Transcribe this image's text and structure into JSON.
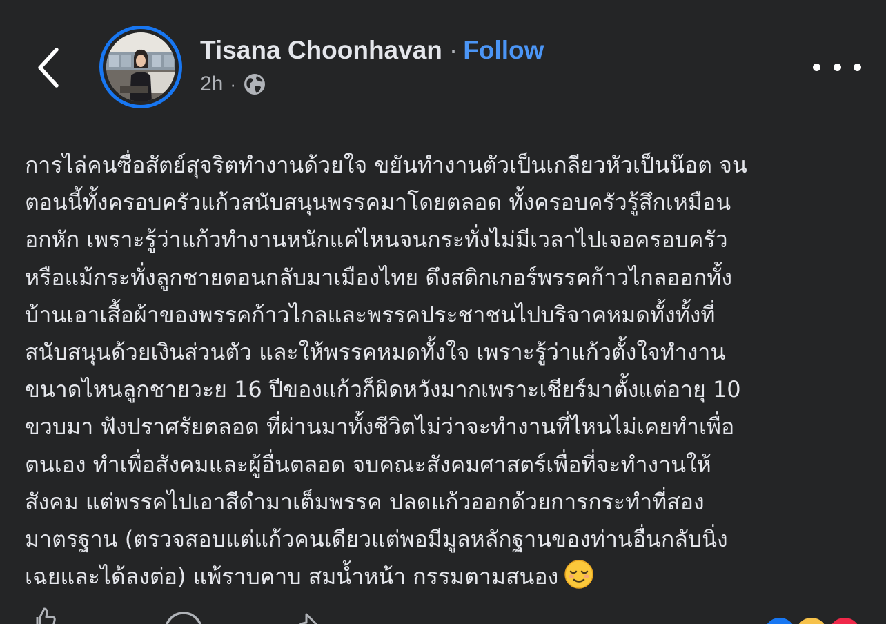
{
  "header": {
    "author_name": "Tisana Choonhavan",
    "separator": "·",
    "follow_label": "Follow",
    "timestamp": "2h",
    "meta_separator": "·",
    "audience_icon": "globe-icon"
  },
  "icons": {
    "back": "chevron-left-icon",
    "more": "more-horizontal-icon",
    "emoji": "relieved-face-emoji"
  },
  "post": {
    "lines": [
      "การไล่คนซื่อสัตย์สุจริตทำงานด้วยใจ ขยันทำงานตัวเป็นเกลียวหัวเป็นน๊อต จน",
      "ตอนนี้ทั้งครอบครัวแก้วสนับสนุนพรรคมาโดยตลอด ทั้งครอบครัวรู้สึกเหมือน",
      "อกหัก เพราะรู้ว่าแก้วทำงานหนักแค่ไหนจนกระทั่งไม่มีเวลาไปเจอครอบครัว",
      "หรือแม้กระทั่งลูกชายตอนกลับมาเมืองไทย ดึงสติกเกอร์พรรคก้าวไกลออกทั้ง",
      "บ้านเอาเสื้อผ้าของพรรคก้าวไกลและพรรคประชาชนไปบริจาคหมดทั้งทั้งที่",
      "สนับสนุนด้วยเงินส่วนตัว และให้พรรคหมดทั้งใจ เพราะรู้ว่าแก้วตั้งใจทำงาน",
      "ขนาดไหนลูกชายวะย 16 ปีของแก้วก็ผิดหวังมากเพราะเชียร์มาตั้งแต่อายุ 10",
      "ขวบมา ฟังปราศรัยตลอด ที่ผ่านมาทั้งชีวิตไม่ว่าจะทำงานที่ไหนไม่เคยทำเพื่อ",
      "ตนเอง ทำเพื่อสังคมและผู้อื่นตลอด จบคณะสังคมศาสตร์เพื่อที่จะทำงานให้",
      "สังคม แต่พรรคไปเอาสีดำมาเต็มพรรค ปลดแก้วออกด้วยการกระทำที่สอง",
      "มาตรฐาน (ตรวจสอบแต่แก้วคนเดียวแต่พอมีมูลหลักฐานของท่านอื่นกลับนิ่ง",
      "เฉยและได้ลงต่อ) แพ้ราบคาบ สมน้ำหน้า กรรมตามสนอง"
    ]
  },
  "colors": {
    "background": "#242526",
    "text": "#e4e6eb",
    "secondary_text": "#b0b3b8",
    "follow": "#4b95f5",
    "avatar_ring": "#1877f2"
  }
}
